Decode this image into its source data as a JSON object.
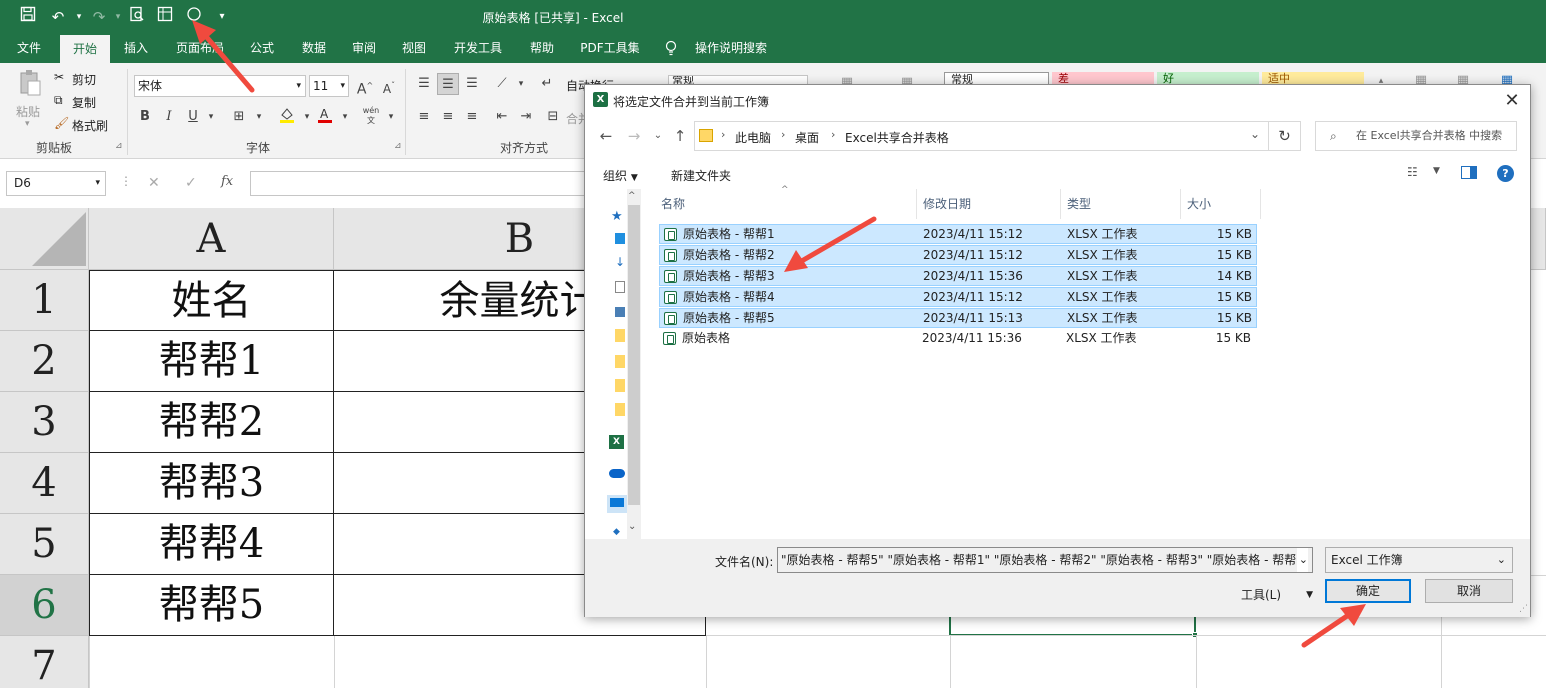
{
  "window": {
    "title": "原始表格  [已共享]  -  Excel"
  },
  "ribbon_tabs": [
    "文件",
    "开始",
    "插入",
    "页面布局",
    "公式",
    "数据",
    "审阅",
    "视图",
    "开发工具",
    "帮助",
    "PDF工具集",
    "操作说明搜索"
  ],
  "ribbon": {
    "paste": "粘贴",
    "cut": "剪切",
    "copy": "复制",
    "format_painter": "格式刷",
    "clipboard_group": "剪贴板",
    "font_name": "宋体",
    "font_size": "11",
    "font_group": "字体",
    "align_group": "对齐方式",
    "wrap_text": "自动换行",
    "merge": "合并",
    "number_format": "常规",
    "style_normal": "常规",
    "style_bad": "差",
    "style_good": "好",
    "style_neutral": "适中"
  },
  "formula_bar": {
    "name_box": "D6",
    "cancel": "✕",
    "enter": "✓",
    "fx": "fx"
  },
  "sheet": {
    "columns": [
      "A",
      "B"
    ],
    "rows": [
      "1",
      "2",
      "3",
      "4",
      "5",
      "6",
      "7"
    ],
    "cells": [
      [
        "姓名",
        "余量统计"
      ],
      [
        "帮帮1",
        ""
      ],
      [
        "帮帮2",
        ""
      ],
      [
        "帮帮3",
        ""
      ],
      [
        "帮帮4",
        ""
      ],
      [
        "帮帮5",
        ""
      ]
    ]
  },
  "dialog": {
    "title": "将选定文件合并到当前工作簿",
    "breadcrumb": [
      "此电脑",
      "桌面",
      "Excel共享合并表格"
    ],
    "search_placeholder": "在 Excel共享合并表格 中搜索",
    "organize": "组织",
    "new_folder": "新建文件夹",
    "columns": [
      "名称",
      "修改日期",
      "类型",
      "大小"
    ],
    "files": [
      {
        "name": "原始表格 - 帮帮1",
        "date": "2023/4/11 15:12",
        "type": "XLSX 工作表",
        "size": "15 KB",
        "selected": true
      },
      {
        "name": "原始表格 - 帮帮2",
        "date": "2023/4/11 15:12",
        "type": "XLSX 工作表",
        "size": "15 KB",
        "selected": true
      },
      {
        "name": "原始表格 - 帮帮3",
        "date": "2023/4/11 15:36",
        "type": "XLSX 工作表",
        "size": "14 KB",
        "selected": true
      },
      {
        "name": "原始表格 - 帮帮4",
        "date": "2023/4/11 15:12",
        "type": "XLSX 工作表",
        "size": "15 KB",
        "selected": true
      },
      {
        "name": "原始表格 - 帮帮5",
        "date": "2023/4/11 15:13",
        "type": "XLSX 工作表",
        "size": "15 KB",
        "selected": true
      },
      {
        "name": "原始表格",
        "date": "2023/4/11 15:36",
        "type": "XLSX 工作表",
        "size": "15 KB",
        "selected": false
      }
    ],
    "filename_label": "文件名(N):",
    "filename_value": "\"原始表格 - 帮帮5\" \"原始表格 - 帮帮1\" \"原始表格 - 帮帮2\" \"原始表格 - 帮帮3\" \"原始表格 - 帮帮",
    "filter": "Excel 工作簿",
    "tools": "工具(L)",
    "ok": "确定",
    "cancel": "取消"
  },
  "colors": {
    "excel_green": "#217346",
    "selection_blue": "#cce8ff",
    "arrow_red": "#f04a3e"
  }
}
